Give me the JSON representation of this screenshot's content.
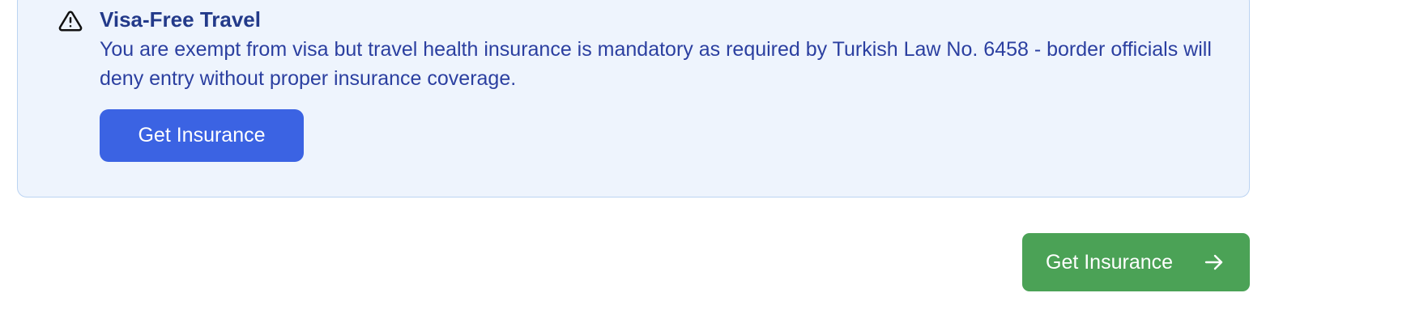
{
  "notice": {
    "icon": "warning-triangle-icon",
    "title": "Visa-Free Travel",
    "body": "You are exempt from visa but travel health insurance is mandatory as required by Turkish Law No. 6458 - border officials will deny entry without proper insurance coverage.",
    "button_label": "Get Insurance",
    "colors": {
      "background": "#eef4fd",
      "border": "#bcd4f2",
      "text": "#2b3fa0",
      "button": "#3b63e3"
    }
  },
  "footer": {
    "button_label": "Get Insurance",
    "button_icon": "arrow-right-icon",
    "button_color": "#4ba256"
  }
}
